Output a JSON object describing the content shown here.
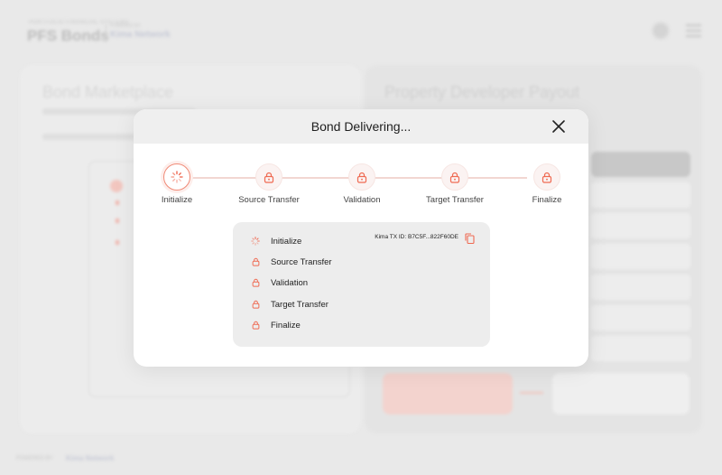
{
  "background": {
    "brand_tagline": "PORTFOLIO FINANCIAL SYSTEMS",
    "brand_name": "PFS Bonds",
    "powered_by": "POWERED BY",
    "network": "Kima Network",
    "left_title": "Bond Marketplace",
    "right_title": "Property Developer Payout",
    "footer_powered": "POWERED BY",
    "footer_network": "Kima Network"
  },
  "modal": {
    "title": "Bond Delivering...",
    "steps": [
      {
        "label": "Initialize",
        "icon": "spinner-icon",
        "state": "active"
      },
      {
        "label": "Source Transfer",
        "icon": "lock-icon",
        "state": "locked"
      },
      {
        "label": "Validation",
        "icon": "lock-icon",
        "state": "locked"
      },
      {
        "label": "Target Transfer",
        "icon": "lock-icon",
        "state": "locked"
      },
      {
        "label": "Finalize",
        "icon": "lock-icon",
        "state": "locked"
      }
    ],
    "status_list": [
      {
        "label": "Initialize",
        "icon": "spinner-icon"
      },
      {
        "label": "Source Transfer",
        "icon": "lock-icon"
      },
      {
        "label": "Validation",
        "icon": "lock-icon"
      },
      {
        "label": "Target Transfer",
        "icon": "lock-icon"
      },
      {
        "label": "Finalize",
        "icon": "lock-icon"
      }
    ],
    "tx_id": "Kima TX ID: B7C5F...822F60DE",
    "accent_color": "#ef6a52"
  }
}
